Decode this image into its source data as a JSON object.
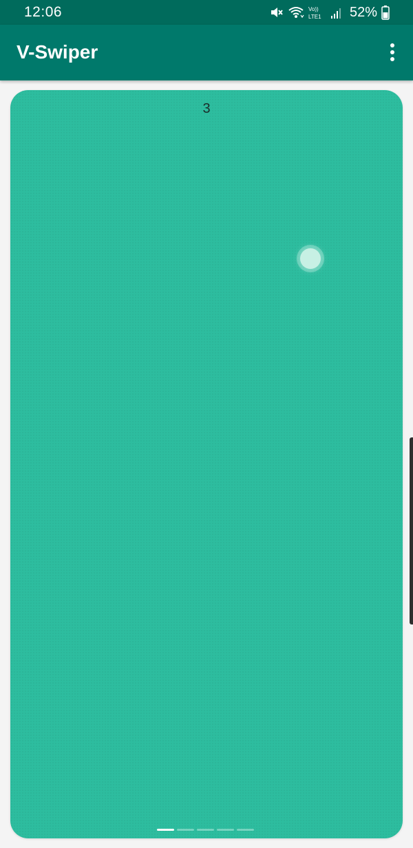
{
  "status_bar": {
    "time": "12:06",
    "battery": "52%",
    "icons": [
      "mute-icon",
      "wifi-icon",
      "volte-lte-icon",
      "signal-icon",
      "battery-icon"
    ]
  },
  "app_bar": {
    "title": "V-Swiper",
    "overflow_icon": "more-vert-icon"
  },
  "swiper": {
    "slide_number": "3",
    "slide_color": "#2dbd9f",
    "page_count": 5,
    "active_page": 1
  },
  "colors": {
    "status_bar": "#006b5c",
    "app_bar": "#00796b",
    "background": "#f4f4f4"
  }
}
